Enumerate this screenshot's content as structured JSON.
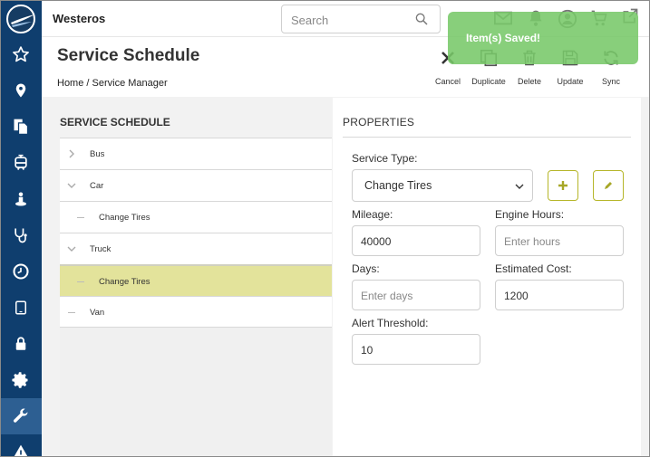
{
  "app": {
    "title": "Westeros"
  },
  "search": {
    "placeholder": "Search"
  },
  "page": {
    "title": "Service Schedule",
    "breadcrumb": [
      "Home",
      "/",
      "Service Manager"
    ]
  },
  "toolbar": {
    "cancel_label": "Cancel",
    "duplicate_label": "Duplicate",
    "delete_label": "Delete",
    "update_label": "Update",
    "sync_label": "Sync"
  },
  "toast": {
    "message": "Item(s) Saved!"
  },
  "schedule_panel": {
    "heading": "SERVICE SCHEDULE",
    "tree": [
      {
        "label": "Bus",
        "level": 0,
        "expanded": false
      },
      {
        "label": "Car",
        "level": 0,
        "expanded": true
      },
      {
        "label": "Change Tires",
        "level": 1
      },
      {
        "label": "Truck",
        "level": 0,
        "expanded": true
      },
      {
        "label": "Change Tires",
        "level": 1,
        "selected": true
      },
      {
        "label": "Van",
        "level": 0,
        "leaf": true
      }
    ]
  },
  "properties": {
    "heading": "PROPERTIES",
    "service_type": {
      "label": "Service Type:",
      "value": "Change Tires"
    },
    "mileage": {
      "label": "Mileage:",
      "value": "40000",
      "placeholder": ""
    },
    "engine_hours": {
      "label": "Engine Hours:",
      "value": "",
      "placeholder": "Enter hours"
    },
    "days": {
      "label": "Days:",
      "value": "",
      "placeholder": "Enter days"
    },
    "estimated_cost": {
      "label": "Estimated Cost:",
      "value": "1200",
      "placeholder": ""
    },
    "alert_threshold": {
      "label": "Alert Threshold:",
      "value": "10",
      "placeholder": ""
    }
  },
  "sidebar": {
    "items": [
      {
        "icon": "star-icon"
      },
      {
        "icon": "map-pin-icon"
      },
      {
        "icon": "documents-icon"
      },
      {
        "icon": "tram-icon"
      },
      {
        "icon": "person-icon"
      },
      {
        "icon": "stethoscope-icon"
      },
      {
        "icon": "clock-icon"
      },
      {
        "icon": "tablet-icon"
      },
      {
        "icon": "lock-icon"
      },
      {
        "icon": "gear-icon"
      },
      {
        "icon": "wrench-icon",
        "active": true
      },
      {
        "icon": "warning-icon"
      }
    ]
  },
  "colors": {
    "sidebar": "#0f3e6e",
    "sidebar_active": "#2d5f92",
    "selected_row": "#e3e39b",
    "accent_button_border": "#b6b62a",
    "toast": "#78c869"
  }
}
